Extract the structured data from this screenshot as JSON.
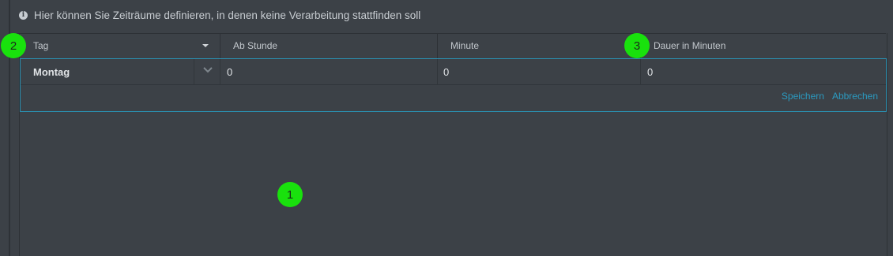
{
  "info": {
    "text": "Hier können Sie Zeiträume definieren, in denen keine Verarbeitung stattfinden soll",
    "icon": "info-circle-icon"
  },
  "table": {
    "columns": [
      "Tag",
      "Ab Stunde",
      "Minute",
      "Dauer in Minuten"
    ],
    "editor": {
      "day": "Montag",
      "hour": "0",
      "minute": "0",
      "duration": "0"
    },
    "actions": {
      "save": "Speichern",
      "cancel": "Abbrechen"
    }
  },
  "badges": [
    "1",
    "2",
    "3"
  ],
  "colors": {
    "background": "#3c4147",
    "accent": "#2a8fb0",
    "link": "#2b9ac0",
    "badge": "#19e10d"
  }
}
